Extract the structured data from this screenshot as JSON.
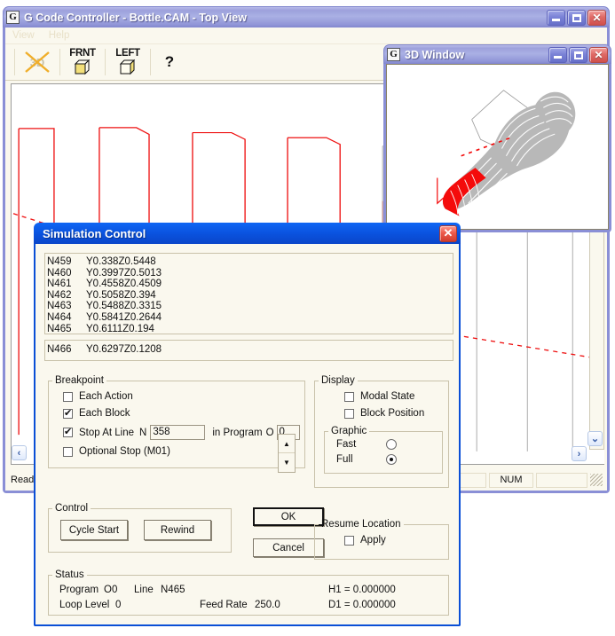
{
  "main_window": {
    "icon": "app-g-icon",
    "title": "G Code Controller - Bottle.CAM - Top View",
    "buttons": {
      "minimize": "minimize-icon",
      "maximize": "maximize-icon",
      "close": "close-icon"
    },
    "menu": [
      "View",
      "Help"
    ],
    "toolbar": [
      {
        "name": "view-3d",
        "label": "3D",
        "disabled": true
      },
      {
        "name": "view-front",
        "label": "FRNT"
      },
      {
        "name": "view-left",
        "label": "LEFT"
      },
      {
        "name": "help",
        "label": "?"
      }
    ],
    "statusbar": {
      "ready": "Ready",
      "num": "NUM"
    },
    "scroll": {
      "left_arrow": "‹",
      "right_arrow": "›",
      "down_arrow": "⌄"
    }
  },
  "window_3d": {
    "icon": "app-g-icon",
    "title": "3D Window",
    "buttons": {
      "minimize": "minimize-icon",
      "maximize": "maximize-icon",
      "close": "close-icon"
    }
  },
  "dialog": {
    "title": "Simulation Control",
    "close": "✕",
    "listing": [
      {
        "n": "N459",
        "code": "Y0.338Z0.5448"
      },
      {
        "n": "N460",
        "code": "Y0.3997Z0.5013"
      },
      {
        "n": "N461",
        "code": "Y0.4558Z0.4509"
      },
      {
        "n": "N462",
        "code": "Y0.5058Z0.394"
      },
      {
        "n": "N463",
        "code": "Y0.5488Z0.3315"
      },
      {
        "n": "N464",
        "code": "Y0.5841Z0.2644"
      },
      {
        "n": "N465",
        "code": "Y0.6111Z0.194"
      }
    ],
    "current_block": {
      "n": "N466",
      "code": "Y0.6297Z0.1208"
    },
    "breakpoint": {
      "legend": "Breakpoint",
      "each_action": {
        "label": "Each Action",
        "checked": false
      },
      "each_block": {
        "label": "Each Block",
        "checked": true
      },
      "stop_at_line": {
        "label": "Stop At Line",
        "checked": true,
        "prefix": "N",
        "value": "358"
      },
      "in_program": {
        "label": "in Program",
        "prefix": "O",
        "value": "0"
      },
      "optional_stop": {
        "label": "Optional Stop (M01)",
        "checked": false
      },
      "spinner": {
        "up": "▲",
        "down": "▼"
      }
    },
    "display": {
      "legend": "Display",
      "modal_state": {
        "label": "Modal State",
        "checked": false
      },
      "block_position": {
        "label": "Block Position",
        "checked": false
      },
      "graphic": {
        "legend": "Graphic",
        "options": [
          {
            "label": "Fast",
            "selected": false
          },
          {
            "label": "Full",
            "selected": true
          }
        ]
      }
    },
    "control": {
      "legend": "Control",
      "cycle_start": "Cycle Start",
      "rewind": "Rewind"
    },
    "resume_location": {
      "legend": "Resume Location",
      "apply": {
        "label": "Apply",
        "checked": false
      }
    },
    "ok": "OK",
    "cancel": "Cancel",
    "status": {
      "legend": "Status",
      "program_label": "Program",
      "program_value": "O0",
      "line_label": "Line",
      "line_value": "N465",
      "loop_label": "Loop Level",
      "loop_value": "0",
      "feed_label": "Feed Rate",
      "feed_value": "250.0",
      "h1": "H1 = 0.000000",
      "d1": "D1 = 0.000000"
    }
  },
  "colors": {
    "toolpath_active": "#ee1111",
    "toolpath_done": "#b6b6b6",
    "title_blue": "#0a5bef",
    "dialog_face": "#faf8ee"
  }
}
